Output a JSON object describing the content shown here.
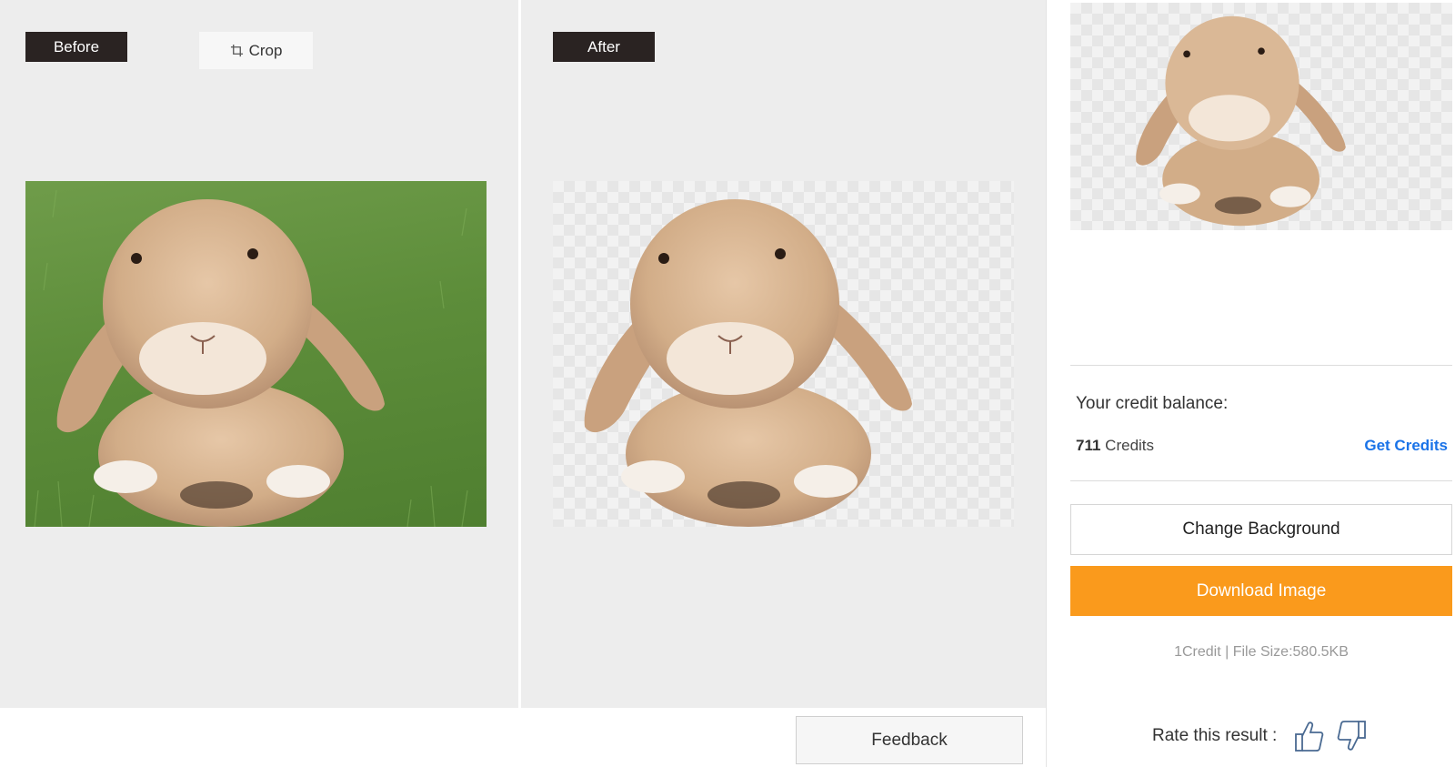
{
  "before_panel": {
    "tag": "Before",
    "crop_label": "Crop"
  },
  "after_panel": {
    "tag": "After"
  },
  "feedback": {
    "label": "Feedback"
  },
  "sidebar": {
    "credit_label": "Your credit balance:",
    "credit_amount": "711",
    "credit_unit": "Credits",
    "get_credits": "Get Credits",
    "change_background": "Change Background",
    "download": "Download Image",
    "file_info": "1Credit | File Size:580.5KB",
    "rate_label": "Rate this result :"
  },
  "colors": {
    "accent": "#fa9a1c",
    "link": "#1a73e8",
    "tag_bg": "#2a2322",
    "panel_bg": "#ededed"
  },
  "icons": [
    "crop-icon",
    "thumbs-up-icon",
    "thumbs-down-icon"
  ]
}
